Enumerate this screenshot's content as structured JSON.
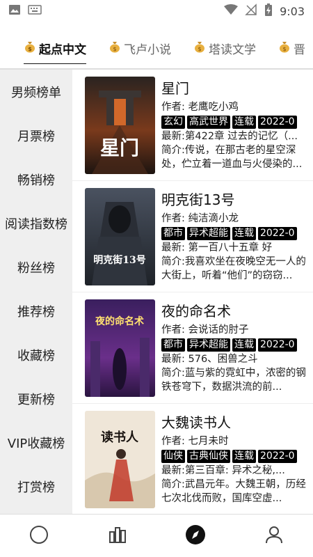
{
  "status": {
    "time": "9:03"
  },
  "tabs": [
    {
      "label": "起点中文"
    },
    {
      "label": "飞卢小说"
    },
    {
      "label": "塔读文学"
    },
    {
      "label": "晋"
    }
  ],
  "sidebar": {
    "items": [
      {
        "label": "男频榜单"
      },
      {
        "label": "月票榜"
      },
      {
        "label": "畅销榜"
      },
      {
        "label": "阅读指数榜"
      },
      {
        "label": "粉丝榜"
      },
      {
        "label": "推荐榜"
      },
      {
        "label": "收藏榜"
      },
      {
        "label": "更新榜"
      },
      {
        "label": "VIP收藏榜"
      },
      {
        "label": "打赏榜"
      }
    ]
  },
  "books": [
    {
      "title": "星门",
      "author": "作者: 老鹰吃小鸡",
      "tags": [
        "玄幻",
        "高武世界",
        "连载",
        "2022-0"
      ],
      "latest": "最新:第422章 过去的记忆（...",
      "intro": "简介:传说，在那古老的星空深处，伫立着一道血与火侵染的...",
      "cover_text": "星门"
    },
    {
      "title": "明克街13号",
      "author": "作者: 纯洁滴小龙",
      "tags": [
        "都市",
        "异术超能",
        "连载",
        "2022-0"
      ],
      "latest": "最新: 第一百八十五章 好",
      "intro": "简介:我喜欢坐在夜晚空无一人的大街上，听着“他们”的窃窃...",
      "cover_text": "明克街13号"
    },
    {
      "title": "夜的命名术",
      "author": "作者: 会说话的肘子",
      "tags": [
        "都市",
        "异术超能",
        "连载",
        "2022-0"
      ],
      "latest": "最新: 576、困兽之斗",
      "intro": "简介:蓝与紫的霓虹中，浓密的钢铁苍穹下，数据洪流的前...",
      "cover_text": "夜的命名术"
    },
    {
      "title": "大魏读书人",
      "author": "作者: 七月未时",
      "tags": [
        "仙侠",
        "古典仙侠",
        "连载",
        "2022-0"
      ],
      "latest": "最新:第三百章: 异术之秘,...",
      "intro": "简介:武昌元年。大魏王朝，历经七次北伐而败，国库空虚...",
      "cover_text": "读书人"
    }
  ],
  "colors": {
    "sidebar_bg": "#efefef",
    "tag_bg": "#000000",
    "nav_active": "#111111"
  },
  "icons": {
    "status_left": [
      "image-icon",
      "keyboard-icon"
    ],
    "status_right": [
      "wifi-icon",
      "no-signal-icon",
      "battery-charging-icon"
    ],
    "tab": "money-bag-icon",
    "nav": [
      "home-circle-icon",
      "bookshelf-icon",
      "compass-icon",
      "profile-icon"
    ]
  }
}
